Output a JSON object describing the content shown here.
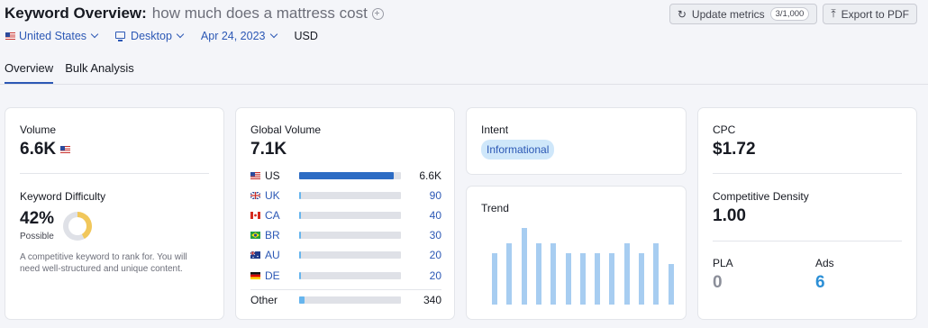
{
  "header": {
    "title": "Keyword Overview:",
    "keyword": "how much does a mattress cost",
    "filters": {
      "country": "United States",
      "device": "Desktop",
      "date": "Apr 24, 2023",
      "currency": "USD"
    },
    "buttons": {
      "update_label": "Update metrics",
      "update_count": "3/1,000",
      "export_label": "Export to PDF"
    }
  },
  "tabs": [
    {
      "label": "Overview",
      "active": true
    },
    {
      "label": "Bulk Analysis",
      "active": false
    }
  ],
  "volume": {
    "label": "Volume",
    "value": "6.6K"
  },
  "keyword_difficulty": {
    "label": "Keyword Difficulty",
    "value": "42%",
    "level": "Possible",
    "percent": 42,
    "description": "A competitive keyword to rank for. You will need well-structured and unique content."
  },
  "global_volume": {
    "label": "Global Volume",
    "value": "7.1K",
    "rows": [
      {
        "code": "US",
        "value": "6.6K",
        "share": 0.93,
        "flag": "us"
      },
      {
        "code": "UK",
        "value": "90",
        "share": 0.02,
        "flag": "uk"
      },
      {
        "code": "CA",
        "value": "40",
        "share": 0.02,
        "flag": "ca"
      },
      {
        "code": "BR",
        "value": "30",
        "share": 0.02,
        "flag": "br"
      },
      {
        "code": "AU",
        "value": "20",
        "share": 0.02,
        "flag": "au"
      },
      {
        "code": "DE",
        "value": "20",
        "share": 0.02,
        "flag": "de"
      }
    ],
    "other": {
      "label": "Other",
      "value": "340",
      "share": 0.05
    }
  },
  "intent": {
    "label": "Intent",
    "value": "Informational"
  },
  "trend": {
    "label": "Trend",
    "values": [
      0.67,
      0.8,
      1.0,
      0.8,
      0.8,
      0.67,
      0.67,
      0.67,
      0.67,
      0.8,
      0.67,
      0.8,
      0.53
    ]
  },
  "cpc": {
    "label": "CPC",
    "value": "$1.72"
  },
  "competitive_density": {
    "label": "Competitive Density",
    "value": "1.00"
  },
  "pla": {
    "label": "PLA",
    "value": "0"
  },
  "ads": {
    "label": "Ads",
    "value": "6"
  },
  "colors": {
    "accent": "#2c58b5",
    "difficulty": "#f1c75b",
    "trend": "#a7cdf1",
    "bar": "#2d6cc4"
  }
}
